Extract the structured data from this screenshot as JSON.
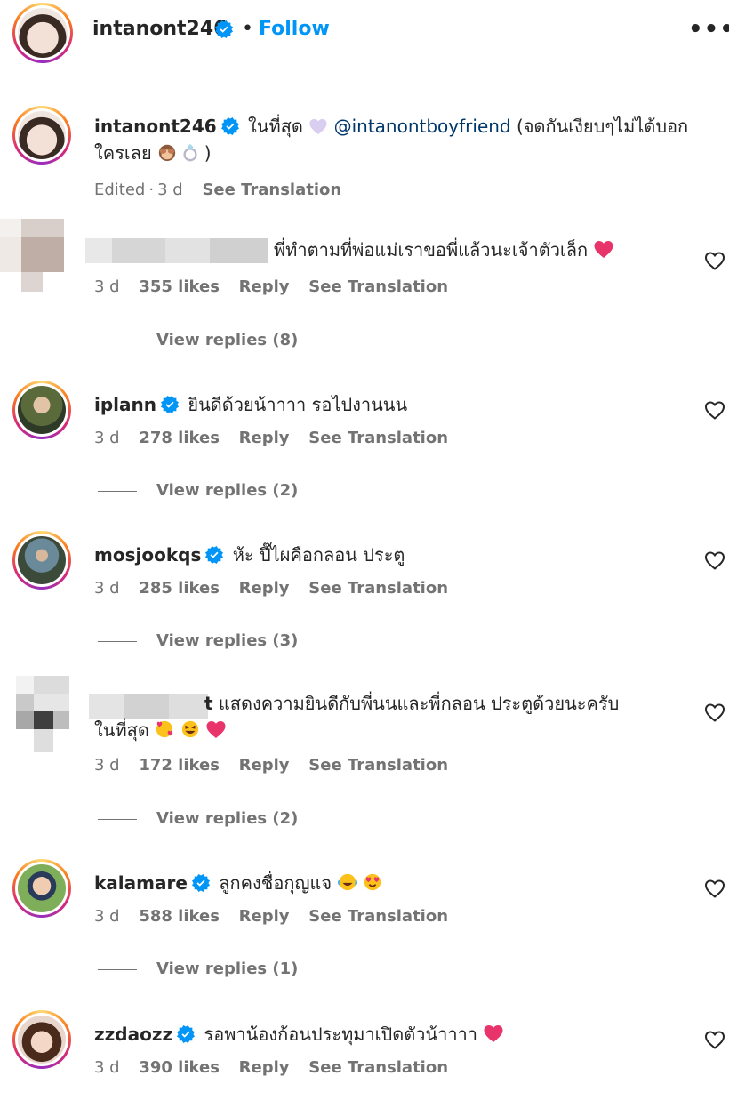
{
  "header": {
    "username": "intanont246",
    "separator": "•",
    "follow_label": "Follow",
    "more_label": "•••"
  },
  "caption": {
    "username": "intanont246",
    "text_before_mention": "ในที่สุด",
    "mention": "@intanontboyfriend",
    "text_after_mention": "(จดกันเงียบๆไม่ได้บอกใครเลย",
    "text_end": ")",
    "edited": "Edited",
    "time": "3 d",
    "see_translation": "See Translation"
  },
  "comments": [
    {
      "username": "",
      "username_censored": true,
      "text": "พี่ทำตามที่พ่อแม่เราขอพี่แล้วนะเจ้าตัวเล็ก",
      "time": "3 d",
      "likes": "355 likes",
      "reply": "Reply",
      "see_translation": "See Translation",
      "view_replies": "View replies (8)"
    },
    {
      "username": "iplann",
      "text": "ยินดีด้วยน้าาาา รอไปงานนน",
      "time": "3 d",
      "likes": "278 likes",
      "reply": "Reply",
      "see_translation": "See Translation",
      "view_replies": "View replies (2)"
    },
    {
      "username": "mosjookqs",
      "text": "ห้ะ ปี๊ไผคือกลอน ประตู",
      "time": "3 d",
      "likes": "285 likes",
      "reply": "Reply",
      "see_translation": "See Translation",
      "view_replies": "View replies (3)"
    },
    {
      "username": "t",
      "username_censored": true,
      "text": "แสดงความยินดีกับพี่นนและพี่กลอน ประตูด้วยนะครับ",
      "text_line2": "ในที่สุด",
      "time": "3 d",
      "likes": "172 likes",
      "reply": "Reply",
      "see_translation": "See Translation",
      "view_replies": "View replies (2)"
    },
    {
      "username": "kalamare",
      "text": "ลูกคงชื่อกุญแจ",
      "time": "3 d",
      "likes": "588 likes",
      "reply": "Reply",
      "see_translation": "See Translation",
      "view_replies": "View replies (1)"
    },
    {
      "username": "zzdaozz",
      "text": "รอพาน้องก้อนประทุมาเปิดตัวน้าาาา",
      "time": "3 d",
      "likes": "390 likes",
      "reply": "Reply",
      "see_translation": "See Translation"
    }
  ],
  "colors": {
    "follow": "#0095f6",
    "verified": "#0095f6",
    "mention": "#00376b",
    "meta": "#737373",
    "heart_emoji": "#e8336b"
  },
  "icons": [
    "verified-badge-icon",
    "more-options-icon",
    "like-heart-icon",
    "purple-heart-emoji",
    "see-no-evil-monkey-emoji",
    "ring-emoji",
    "red-heart-emoji",
    "smiling-face-with-hearts-emoji",
    "grinning-squinting-face-emoji",
    "face-with-tears-of-joy-emoji",
    "heart-eyes-emoji"
  ]
}
